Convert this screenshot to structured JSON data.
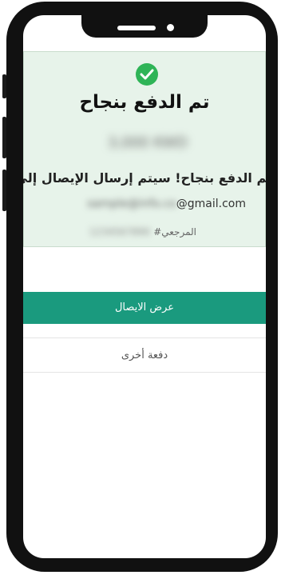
{
  "success": {
    "title": "تم الدفع بنجاح",
    "amount": "3,000 KWD",
    "message": "تم الدفع بنجاح! سيتم إرسال الإيصال إلى:",
    "email_masked": "sample@info.co",
    "email_domain": "@gmail.com",
    "ref_label": "المرجعي#",
    "ref_masked": "1234567890"
  },
  "actions": {
    "view_receipt": "عرض الايصال",
    "another_payment": "دفعة أخرى"
  },
  "colors": {
    "success_bg": "#e7f3ea",
    "check_green": "#2fb457",
    "primary": "#1a9a7e"
  },
  "icons": {
    "status": "check-circle-icon"
  }
}
